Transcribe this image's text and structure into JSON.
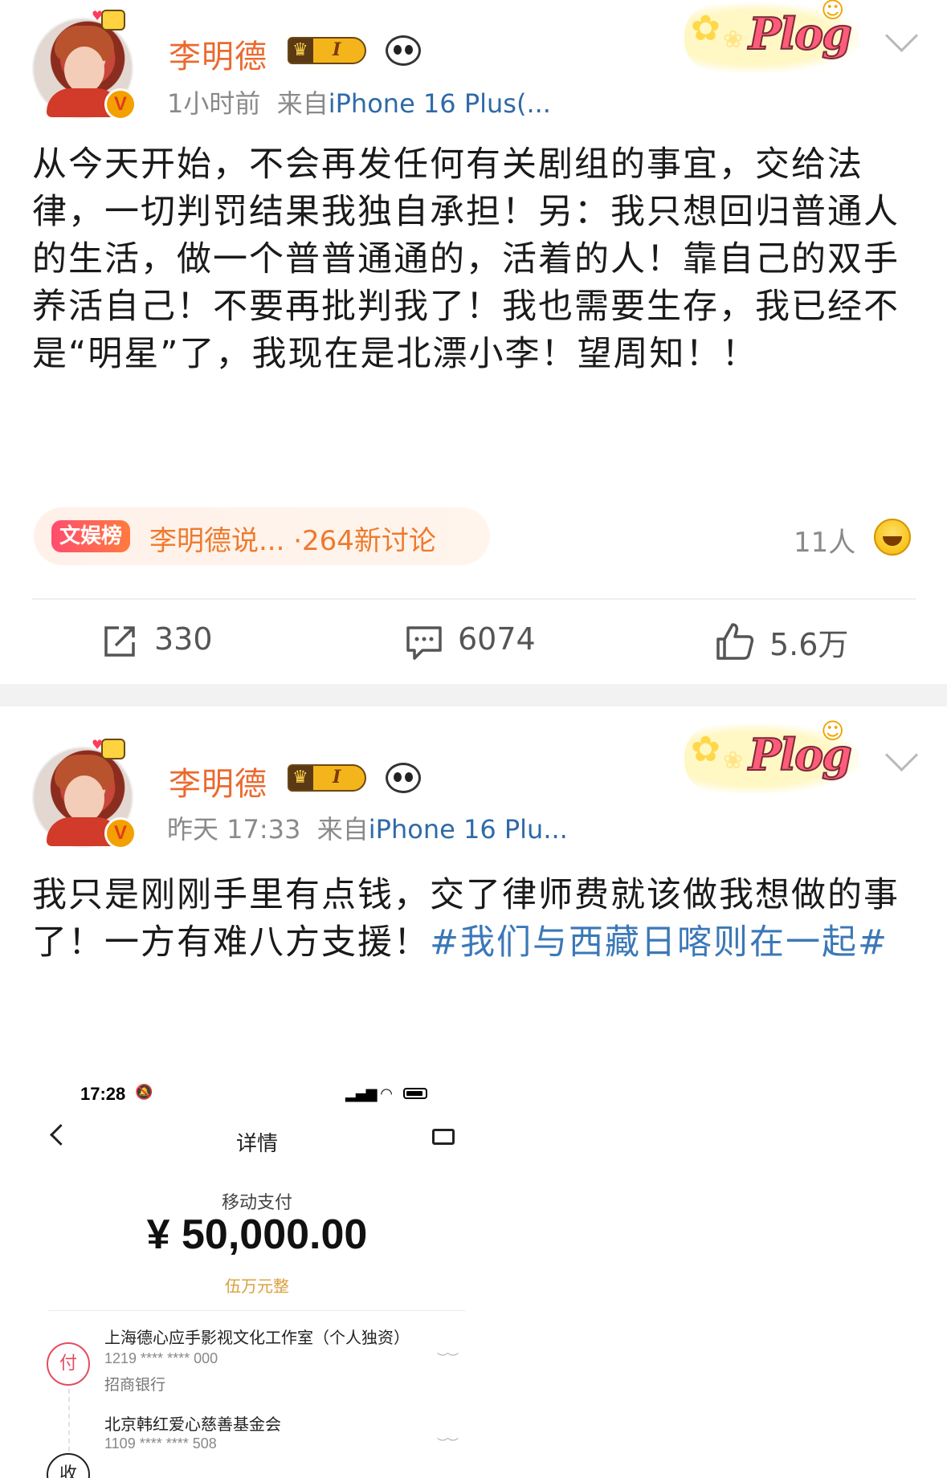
{
  "post1": {
    "username": "李明德",
    "badge_level": "I",
    "time": "1小时前",
    "source_prefix": "来自",
    "source": "iPhone 16 Plus(...",
    "plog": "Plog",
    "text": "从今天开始，不会再发任何有关剧组的事宜，交给法律，一切判罚结果我独自承担！另：我只想回归普通人的生活，做一个普普通通的，活着的人！靠自己的双手养活自己！不要再批判我了！我也需要生存，我已经不是“明星”了，我现在是北漂小李！望周知！！",
    "topic_label": "文娱榜",
    "topic_text": "李明德说... ·264新讨论",
    "people": "11人",
    "repost_count": "330",
    "comment_count": "6074",
    "like_count": "5.6万"
  },
  "post2": {
    "username": "李明德",
    "badge_level": "I",
    "time": "昨天 17:33",
    "source_prefix": "来自",
    "source": "iPhone 16 Plu...",
    "plog": "Plog",
    "text_main": "我只是刚刚手里有点钱，交了律师费就该做我想做的事了！一方有难八方支援！",
    "hashtag": "#我们与西藏日喀则在一起#"
  },
  "receipt": {
    "status_time": "17:28",
    "title": "详情",
    "label": "移动支付",
    "amount": "¥ 50,000.00",
    "amount_words": "伍万元整",
    "payer_icon": "付",
    "payer_name": "上海德心应手影视文化工作室（个人独资）",
    "payer_account": "1219 **** **** 000",
    "payer_bank": "招商银行",
    "payee_icon": "收",
    "payee_name": "北京韩红爱心慈善基金会",
    "payee_account": "1109 **** **** 508"
  },
  "colors": {
    "username": "#ea6a2f",
    "link": "#2f6aa8",
    "hashtag": "#3b78b7",
    "meta": "#8a8a8a"
  }
}
